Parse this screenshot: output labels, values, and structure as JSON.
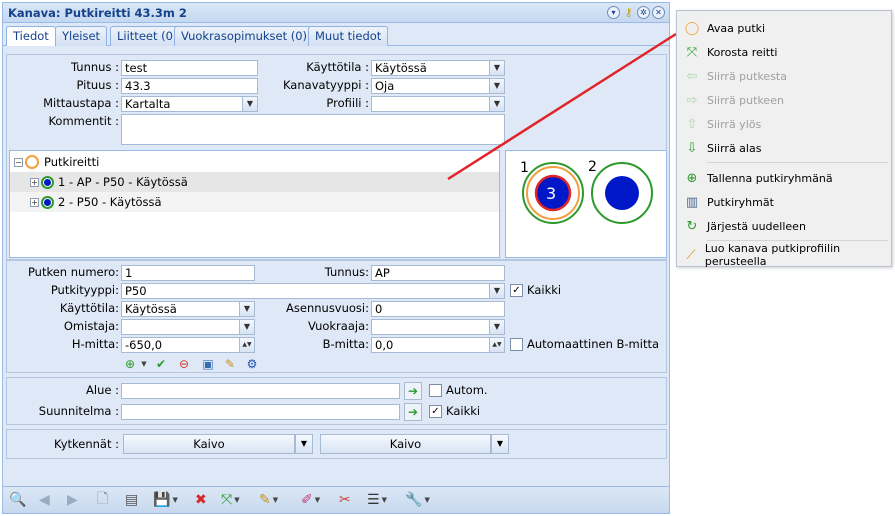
{
  "window": {
    "title": "Kanava: Putkireitti 43.3m 2"
  },
  "tabs": [
    {
      "label": "Tiedot"
    },
    {
      "label": "Yleiset"
    },
    {
      "label": "Liitteet (0)"
    },
    {
      "label": "Vuokrasopimukset (0)"
    },
    {
      "label": "Muut tiedot"
    }
  ],
  "general": {
    "tunnus_label": "Tunnus :",
    "tunnus_value": "test",
    "pituus_label": "Pituus :",
    "pituus_value": "43.3",
    "mittaustapa_label": "Mittaustapa :",
    "mittaustapa_value": "Kartalta",
    "kommentit_label": "Kommentit :",
    "kayttotila_label": "Käyttötila :",
    "kayttotila_value": "Käytössä",
    "kanavatyyppi_label": "Kanavatyyppi :",
    "kanavatyyppi_value": "Oja",
    "profiili_label": "Profiili :",
    "profiili_value": ""
  },
  "tree": {
    "root": "Putkireitti",
    "items": [
      {
        "label": "1 - AP - P50 - Käytössä",
        "selected": true
      },
      {
        "label": "2 - P50 - Käytössä",
        "selected": false
      }
    ]
  },
  "preview": {
    "label1": "1",
    "label2": "2",
    "count": "3"
  },
  "pipe": {
    "numero_label": "Putken numero:",
    "numero_value": "1",
    "tunnus_label": "Tunnus:",
    "tunnus_value": "AP",
    "tyyppi_label": "Putkityyppi:",
    "tyyppi_value": "P50",
    "kaikki_label": "Kaikki",
    "kayttotila_label": "Käyttötila:",
    "kayttotila_value": "Käytössä",
    "asennusvuosi_label": "Asennusvuosi:",
    "asennusvuosi_value": "0",
    "omistaja_label": "Omistaja:",
    "omistaja_value": "",
    "vuokraaja_label": "Vuokraaja:",
    "vuokraaja_value": "",
    "hmitta_label": "H-mitta:",
    "hmitta_value": "-650,0",
    "bmitta_label": "B-mitta:",
    "bmitta_value": "0,0",
    "auto_b_label": "Automaattinen B-mitta"
  },
  "area": {
    "alue_label": "Alue :",
    "alue_value": "",
    "autom_label": "Autom.",
    "suunnitelma_label": "Suunnitelma :",
    "suunnitelma_value": "",
    "kaikki_label": "Kaikki"
  },
  "connections": {
    "label": "Kytkennät :",
    "left": "Kaivo",
    "right": "Kaivo"
  },
  "context_menu": {
    "items": [
      {
        "label": "Avaa putki",
        "icon": "circle-outline-icon",
        "disabled": false
      },
      {
        "label": "Korosta reitti",
        "icon": "arrows-in-icon",
        "disabled": false
      },
      {
        "label": "Siirrä putkesta",
        "icon": "arrow-left-icon",
        "disabled": true
      },
      {
        "label": "Siirrä putkeen",
        "icon": "arrow-right-icon",
        "disabled": true
      },
      {
        "label": "Siirrä ylös",
        "icon": "arrow-up-icon",
        "disabled": true
      },
      {
        "label": "Siirrä alas",
        "icon": "arrow-down-icon",
        "disabled": false
      },
      {
        "label": "Tallenna putkiryhmänä",
        "icon": "add-icon",
        "disabled": false
      },
      {
        "label": "Putkiryhmät",
        "icon": "pipe-groups-icon",
        "disabled": false
      },
      {
        "label": "Järjestä uudelleen",
        "icon": "reorder-icon",
        "disabled": false
      },
      {
        "label": "Luo kanava putkiprofiilin perusteella",
        "icon": "ruler-icon",
        "disabled": false
      }
    ]
  },
  "colors": {
    "accent": "#15428b",
    "panel": "#dfe8f6",
    "arrow": "#e0242a",
    "selected_pipe": "#0018c8"
  }
}
